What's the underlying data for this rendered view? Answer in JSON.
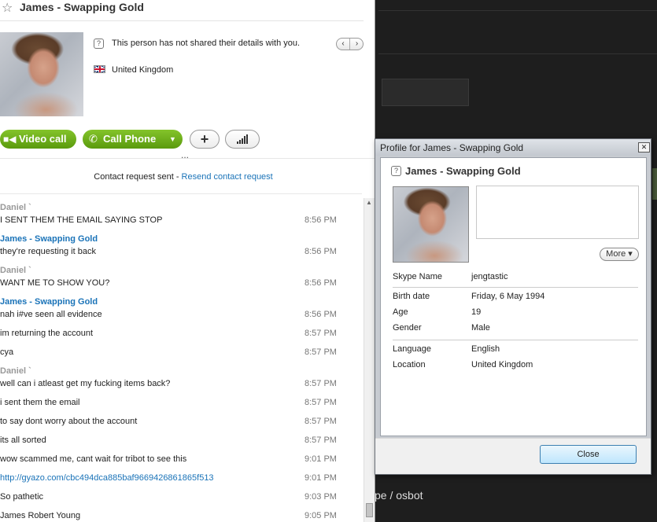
{
  "chat": {
    "title": "James - Swapping Gold",
    "info_text": "This person has not shared their details with you.",
    "location": "United Kingdom",
    "buttons": {
      "video_call": "Video call",
      "call_phone": "Call Phone"
    },
    "request": {
      "text": "Contact request sent - ",
      "link": "Resend contact request"
    },
    "ellipsis": "...",
    "messages": [
      {
        "sender": "Daniel `",
        "side": "me",
        "text": "I SENT THEM THE EMAIL SAYING STOP",
        "time": "8:56 PM"
      },
      {
        "sender": "James - Swapping Gold",
        "side": "them",
        "text": "they're requesting it back",
        "time": "8:56 PM"
      },
      {
        "sender": "Daniel `",
        "side": "me",
        "text": "WANT ME TO SHOW YOU?",
        "time": "8:56 PM"
      },
      {
        "sender": "James - Swapping Gold",
        "side": "them",
        "text": "nah i#ve seen all evidence",
        "time": "8:56 PM"
      },
      {
        "sender": "",
        "side": "them",
        "text": "im returning the account",
        "time": "8:57 PM"
      },
      {
        "sender": "",
        "side": "them",
        "text": "cya",
        "time": "8:57 PM"
      },
      {
        "sender": "Daniel `",
        "side": "me",
        "text": "well can i atleast get my fucking items back?",
        "time": "8:57 PM"
      },
      {
        "sender": "",
        "side": "me",
        "text": "i sent them the email",
        "time": "8:57 PM"
      },
      {
        "sender": "",
        "side": "me",
        "text": "to say dont worry about the account",
        "time": "8:57 PM"
      },
      {
        "sender": "",
        "side": "me",
        "text": "its all sorted",
        "time": "8:57 PM"
      },
      {
        "sender": "",
        "side": "me",
        "text": "wow scammed me, cant wait for tribot to see this",
        "time": "9:01 PM"
      },
      {
        "sender": "",
        "side": "me",
        "text": "http://gyazo.com/cbc494dca885baf9669426861865f513",
        "time": "9:01 PM",
        "link": true
      },
      {
        "sender": "",
        "side": "me",
        "text": "So pathetic",
        "time": "9:03 PM"
      },
      {
        "sender": "",
        "side": "me",
        "text": "James Robert Young",
        "time": "9:05 PM"
      }
    ]
  },
  "background": {
    "text": "pe / osbot"
  },
  "dialog": {
    "title": "Profile for James - Swapping Gold",
    "name": "James - Swapping Gold",
    "more_label": "More",
    "fields": {
      "skype_name": {
        "label": "Skype Name",
        "value": "jengtastic"
      },
      "birth_date": {
        "label": "Birth date",
        "value": "Friday, 6 May 1994"
      },
      "age": {
        "label": "Age",
        "value": "19"
      },
      "gender": {
        "label": "Gender",
        "value": "Male"
      },
      "language": {
        "label": "Language",
        "value": "English"
      },
      "location": {
        "label": "Location",
        "value": "United Kingdom"
      }
    },
    "close_label": "Close"
  },
  "colors": {
    "skype_green": "#6fb01b",
    "link_blue": "#1a73b8",
    "sender_gray": "#999999",
    "dark_bg": "#1e1e1e"
  },
  "icons": [
    "star-icon",
    "info-icon",
    "uk-flag-icon",
    "video-camera-icon",
    "phone-icon",
    "plus-icon",
    "signal-bars-icon",
    "chevron-left-icon",
    "chevron-right-icon",
    "close-icon"
  ]
}
